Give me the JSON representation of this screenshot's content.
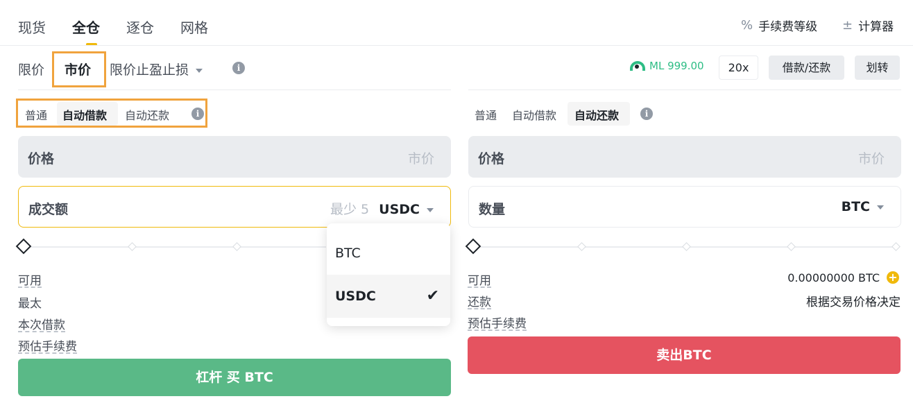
{
  "top_tabs": [
    "现货",
    "全仓",
    "逐仓",
    "网格"
  ],
  "top_right": {
    "fee_label": "手续费等级",
    "fee_icon": "percent-icon",
    "calc_label": "计算器",
    "calc_icon": "calculator-icon"
  },
  "order_types": {
    "limit": "限价",
    "market": "市价",
    "stop": "限价止盈止损"
  },
  "ml": "ML 999.00",
  "leverage": "20x",
  "borrow_repay": "借款/还款",
  "transfer": "划转",
  "buy": {
    "modes": [
      "普通",
      "自动借款",
      "自动还款"
    ],
    "price_label": "价格",
    "price_value": "市价",
    "amount_label": "成交额",
    "amount_min": "最少 5",
    "amount_unit": "USDC",
    "info_labels": [
      "可用",
      "最太",
      "本次借款",
      "预估手续费"
    ],
    "button": "杠杆 买 BTC"
  },
  "sell": {
    "modes": [
      "普通",
      "自动借款",
      "自动还款"
    ],
    "price_label": "价格",
    "price_value": "市价",
    "qty_label": "数量",
    "qty_unit": "BTC",
    "info_labels": [
      "可用",
      "还款",
      "预估手续费"
    ],
    "available_value": "0.00000000 BTC",
    "repay_value": "根据交易价格决定",
    "button": "卖出BTC"
  },
  "dropdown": {
    "options": [
      "BTC",
      "USDC"
    ],
    "selected": "USDC"
  },
  "colors": {
    "accent": "#f0b90b",
    "highlight": "#f0a33d",
    "buy": "#5ab987",
    "sell": "#e55360",
    "ml": "#2ebd85"
  }
}
